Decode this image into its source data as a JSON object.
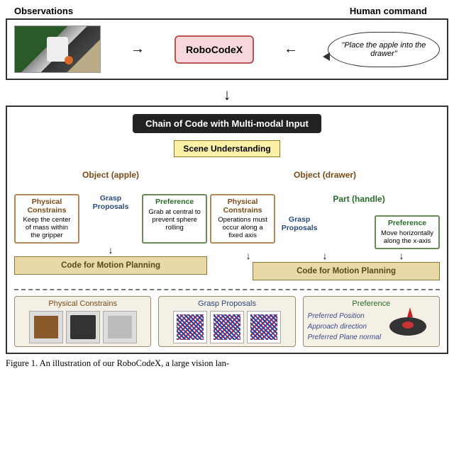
{
  "top": {
    "observations_label": "Observations",
    "command_label": "Human command",
    "system_name": "RoboCodeX",
    "command_text": "\"Place the apple into the drawer\""
  },
  "chain_title": "Chain of Code with Multi-modal Input",
  "scene_title": "Scene Understanding",
  "objects": {
    "apple": {
      "label": "Object (apple)",
      "physical": {
        "title": "Physical Constrains",
        "text": "Keep the center of mass within the gripper"
      },
      "grasp": {
        "title": "Grasp Proposals"
      },
      "preference": {
        "title": "Preference",
        "text": "Grab at central to prevent sphere rolling"
      },
      "code": "Code for Motion Planning"
    },
    "drawer": {
      "label": "Object (drawer)",
      "physical": {
        "title": "Physical Constrains",
        "text": "Operations must occur along a fixed axis"
      },
      "part_label": "Part (handle)",
      "grasp": {
        "title": "Grasp Proposals"
      },
      "preference": {
        "title": "Preference",
        "text": "Move horizontally along the x-axis"
      },
      "code": "Code for Motion Planning"
    }
  },
  "bottom_panels": {
    "physical": "Physical Constrains",
    "grasp": "Grasp Proposals",
    "preference": "Preference",
    "pref_items": [
      "Preferred Position",
      "Approach direction",
      "Preferred Plane normal"
    ]
  },
  "caption": "Figure 1. An illustration of our RoboCodeX, a large vision lan-"
}
